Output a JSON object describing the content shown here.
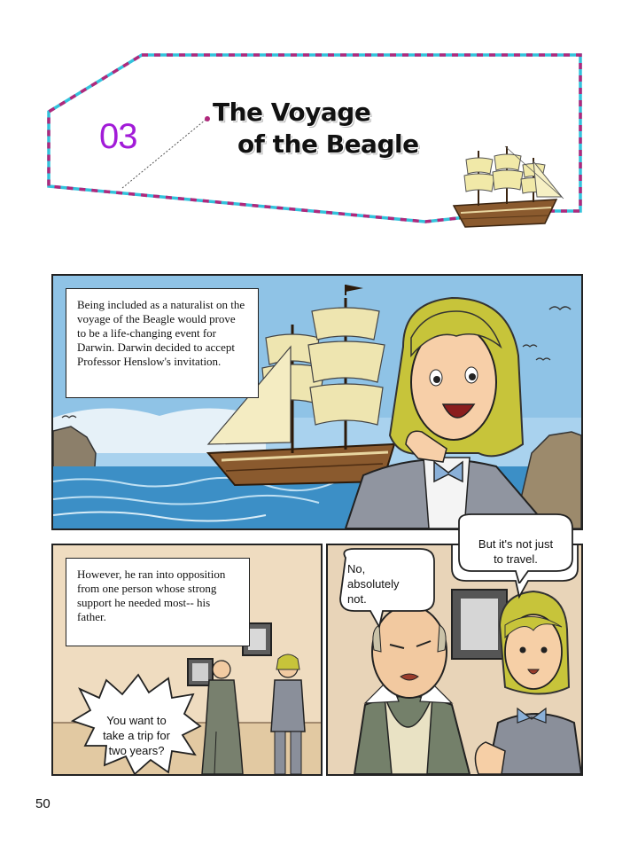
{
  "chapter": {
    "number": "03",
    "title_line1": "The Voyage",
    "title_line2": "of the Beagle"
  },
  "panels": {
    "panel1": {
      "caption": "Being included as a naturalist on the voyage of the Beagle would prove to be a life-changing event for Darwin. Darwin decided to accept Professor Henslow's invitation."
    },
    "panel2": {
      "caption": "However, he ran into opposition from one person whose strong support he needed most-- his father.",
      "bubble": "You want to\ntake a trip for\ntwo years?"
    },
    "panel3": {
      "bubble_father": "No,\nabsolutely\nnot.",
      "bubble_darwin": "But it's not just\nto travel."
    }
  },
  "page_number": "50",
  "colors": {
    "accent_purple": "#a21bd8",
    "frame_cyan": "#33c3dc",
    "frame_magenta": "#b0287c",
    "sky_blue": "#8fc3e6",
    "hair_yellow": "#c7c43a",
    "wall_beige": "#efdcc0"
  }
}
